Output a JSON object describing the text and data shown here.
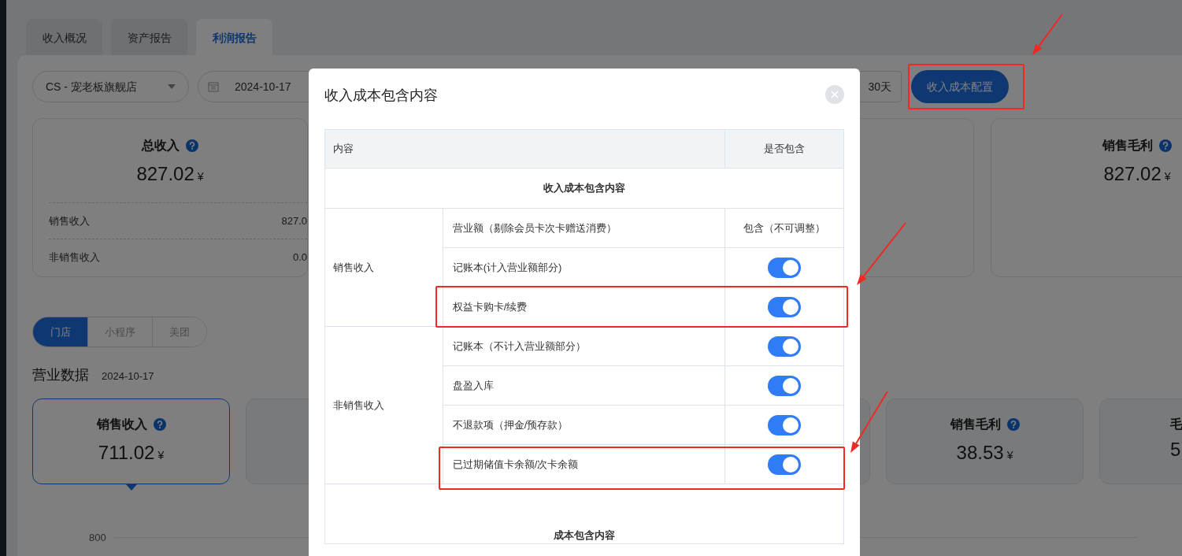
{
  "tabs": [
    {
      "label": "收入概况",
      "selected": false
    },
    {
      "label": "资产报告",
      "selected": false
    },
    {
      "label": "利润报告",
      "selected": true
    }
  ],
  "filters": {
    "store": "CS - 宠老板旗舰店",
    "date": "2024-10-17",
    "range": "30天",
    "config_button": "收入成本配置"
  },
  "summary_cards": [
    {
      "title": "总收入",
      "value": "827.02",
      "currency": "¥",
      "rows": [
        {
          "label": "销售收入",
          "value": "827.0"
        },
        {
          "label": "非销售收入",
          "value": "0.0"
        }
      ]
    },
    {
      "title": "销售毛利",
      "value": "827.02",
      "currency": "¥"
    }
  ],
  "channel_tabs": [
    {
      "label": "门店",
      "selected": true
    },
    {
      "label": "小程序",
      "selected": false
    },
    {
      "label": "美团",
      "selected": false
    }
  ],
  "section": {
    "title": "营业数据",
    "date": "2024-10-17"
  },
  "metric_cards": [
    {
      "title": "销售收入",
      "value": "711.02",
      "currency": "¥",
      "selected": true
    },
    {
      "title": "销售毛利",
      "value": "38.53",
      "currency": "¥",
      "selected": false
    },
    {
      "title": "毛",
      "value": "5",
      "selected": false
    }
  ],
  "chart": {
    "axis_label": "800"
  },
  "dialog": {
    "title": "收入成本包含内容",
    "columns": [
      "内容",
      "是否包含"
    ],
    "sections": [
      {
        "title": "收入成本包含内容",
        "groups": [
          {
            "name": "销售收入",
            "items": [
              {
                "label": "营业额（剔除会员卡次卡赠送消费）",
                "kind": "text",
                "value": "包含（不可调整）"
              },
              {
                "label": "记账本(计入营业额部分)",
                "kind": "switch",
                "on": true
              },
              {
                "label": "权益卡购卡/续费",
                "kind": "switch",
                "on": true
              }
            ]
          },
          {
            "name": "非销售收入",
            "items": [
              {
                "label": "记账本（不计入营业额部分）",
                "kind": "switch",
                "on": true
              },
              {
                "label": "盘盈入库",
                "kind": "switch",
                "on": true
              },
              {
                "label": "不退款项（押金/预存款）",
                "kind": "switch",
                "on": true
              },
              {
                "label": "已过期储值卡余额/次卡余额",
                "kind": "switch",
                "on": true
              }
            ]
          }
        ]
      },
      {
        "title": "成本包含内容"
      }
    ]
  }
}
